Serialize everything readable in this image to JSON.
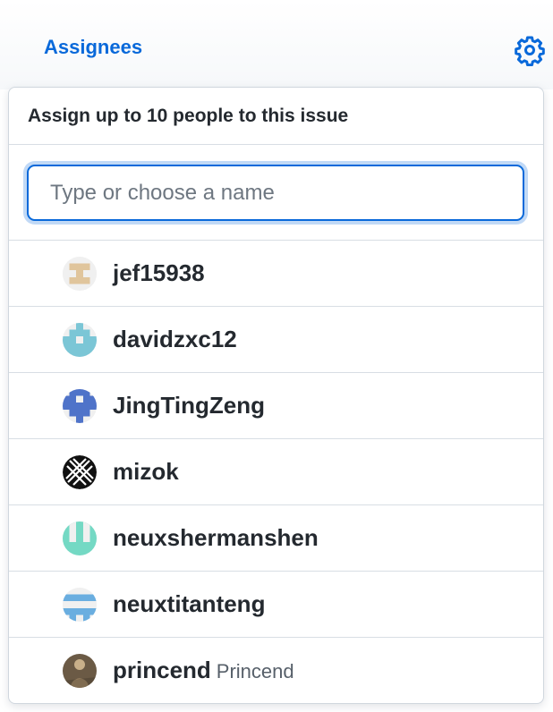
{
  "sidebar": {
    "title": "Assignees",
    "settings_icon": "gear-icon"
  },
  "popover": {
    "header": "Assign up to 10 people to this issue",
    "filter_placeholder": "Type or choose a name",
    "filter_value": "",
    "users": [
      {
        "login": "jef15938",
        "name": "",
        "avatar": "identicon-tan"
      },
      {
        "login": "davidzxc12",
        "name": "",
        "avatar": "identicon-lightblue"
      },
      {
        "login": "JingTingZeng",
        "name": "",
        "avatar": "identicon-blue"
      },
      {
        "login": "mizok",
        "name": "",
        "avatar": "striped-logo"
      },
      {
        "login": "neuxshermanshen",
        "name": "",
        "avatar": "identicon-teal"
      },
      {
        "login": "neuxtitanteng",
        "name": "",
        "avatar": "identicon-skyblue"
      },
      {
        "login": "princend",
        "name": "Princend",
        "avatar": "photo"
      }
    ]
  },
  "colors": {
    "link_blue": "#0969da",
    "text": "#24292f",
    "muted": "#57606a",
    "border": "#d0d7de"
  }
}
